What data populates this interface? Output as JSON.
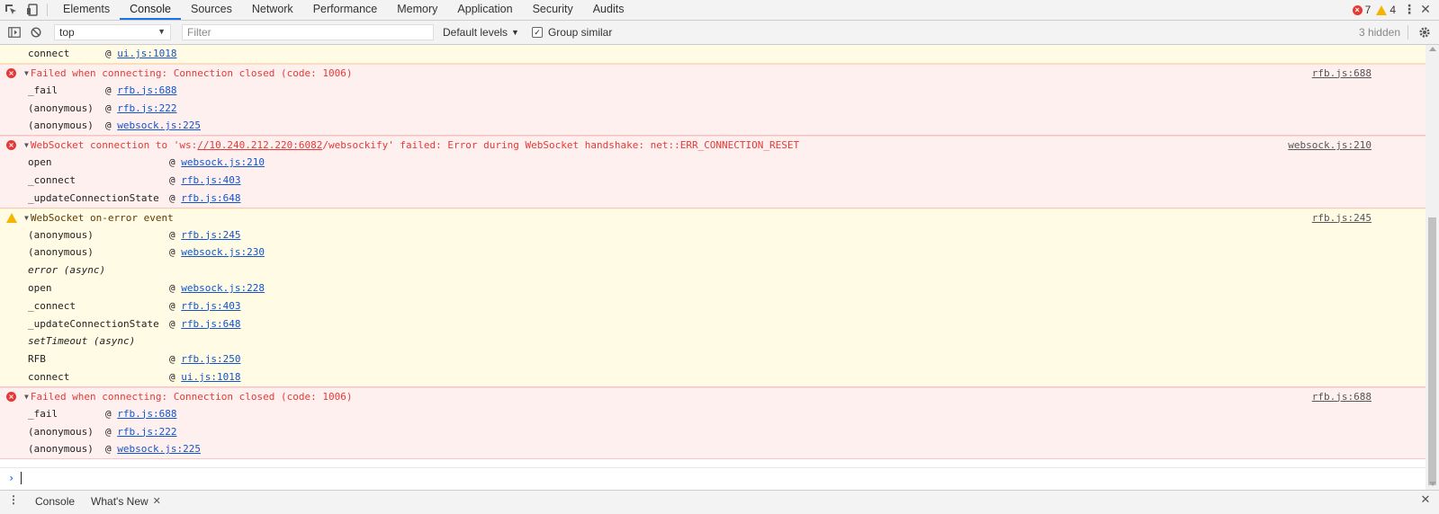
{
  "tabs": [
    "Elements",
    "Console",
    "Sources",
    "Network",
    "Performance",
    "Memory",
    "Application",
    "Security",
    "Audits"
  ],
  "counts": {
    "errors": "7",
    "warnings": "4"
  },
  "toolbar": {
    "context": "top",
    "filter_placeholder": "Filter",
    "levels": "Default levels",
    "group_similar": "Group similar",
    "hidden": "3 hidden"
  },
  "messages": [
    {
      "type": "partial-warning",
      "frames": [
        {
          "fn": "connect",
          "at": "@ ",
          "link": "ui.js:1018"
        }
      ]
    },
    {
      "type": "error",
      "text": "Failed when connecting: Connection closed (code: 1006)",
      "source": "rfb.js:688",
      "frames": [
        {
          "fn": "_fail",
          "at": "@ ",
          "link": "rfb.js:688"
        },
        {
          "fn": "(anonymous)",
          "at": "@ ",
          "link": "rfb.js:222"
        },
        {
          "fn": "(anonymous)",
          "at": "@ ",
          "link": "websock.js:225"
        }
      ]
    },
    {
      "type": "error",
      "text_pre": "WebSocket connection to 'ws:",
      "text_link": "//10.240.212.220:6082",
      "text_post": "/websockify' failed: Error during WebSocket handshake: net::ERR_CONNECTION_RESET",
      "source": "websock.js:210",
      "frames": [
        {
          "fn": "open",
          "at": "@ ",
          "link": "websock.js:210"
        },
        {
          "fn": "_connect",
          "at": "@ ",
          "link": "rfb.js:403"
        },
        {
          "fn": "_updateConnectionState",
          "at": "@ ",
          "link": "rfb.js:648"
        }
      ]
    },
    {
      "type": "warning",
      "text": "WebSocket on-error event",
      "source": "rfb.js:245",
      "frames": [
        {
          "fn": "(anonymous)",
          "at": "@ ",
          "link": "rfb.js:245"
        },
        {
          "fn": "(anonymous)",
          "at": "@ ",
          "link": "websock.js:230"
        },
        {
          "async": "error (async)"
        },
        {
          "fn": "open",
          "at": "@ ",
          "link": "websock.js:228"
        },
        {
          "fn": "_connect",
          "at": "@ ",
          "link": "rfb.js:403"
        },
        {
          "fn": "_updateConnectionState",
          "at": "@ ",
          "link": "rfb.js:648"
        },
        {
          "async": "setTimeout (async)"
        },
        {
          "fn": "RFB",
          "at": "@ ",
          "link": "rfb.js:250"
        },
        {
          "fn": "connect",
          "at": "@ ",
          "link": "ui.js:1018"
        }
      ]
    },
    {
      "type": "error",
      "text": "Failed when connecting: Connection closed (code: 1006)",
      "source": "rfb.js:688",
      "frames": [
        {
          "fn": "_fail",
          "at": "@ ",
          "link": "rfb.js:688"
        },
        {
          "fn": "(anonymous)",
          "at": "@ ",
          "link": "rfb.js:222"
        },
        {
          "fn": "(anonymous)",
          "at": "@ ",
          "link": "websock.js:225"
        }
      ]
    }
  ],
  "drawer": {
    "tabs": [
      "Console",
      "What's New"
    ]
  },
  "icons": {
    "inspect": "inspect-element-icon",
    "device": "device-toolbar-icon",
    "sidebar": "console-sidebar-icon",
    "clear": "clear-console-icon",
    "settings": "gear-icon"
  },
  "colors": {
    "error_text": "#e53935",
    "warning_bg": "#fffbe5",
    "error_bg": "#fff0f0",
    "accent": "#1a73e8"
  }
}
